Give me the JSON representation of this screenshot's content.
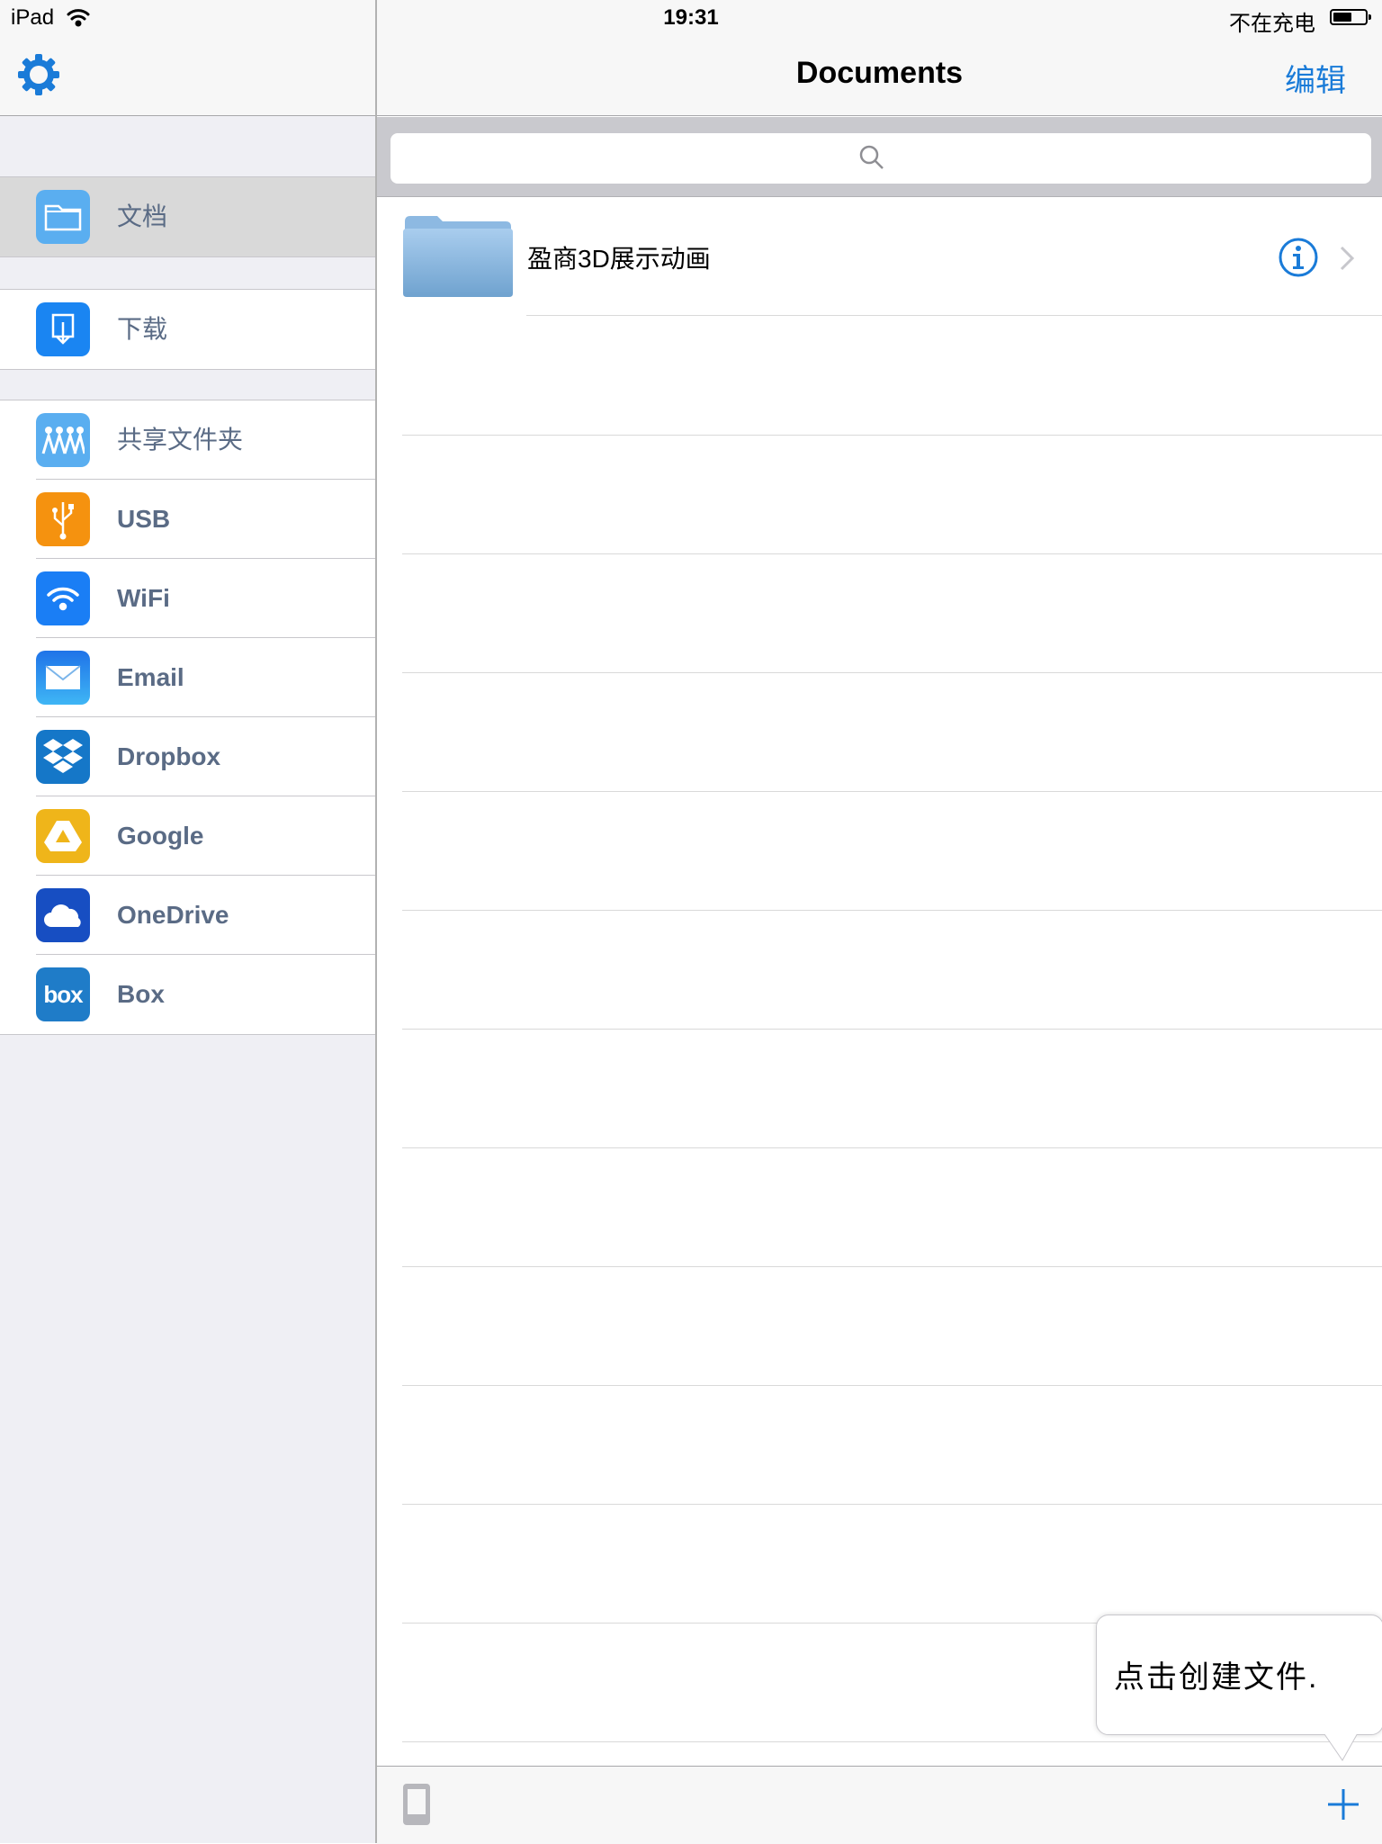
{
  "status_bar": {
    "device": "iPad",
    "time": "19:31",
    "charging": "不在充电",
    "battery_level": 0.6
  },
  "sidebar": {
    "groups": [
      [
        {
          "label": "文档",
          "icon": "folder-icon",
          "active": true
        }
      ],
      [
        {
          "label": "下载",
          "icon": "download-icon"
        }
      ],
      [
        {
          "label": "共享文件夹",
          "icon": "shared-people-icon"
        },
        {
          "label": "USB",
          "icon": "usb-icon"
        },
        {
          "label": "WiFi",
          "icon": "wifi-icon"
        },
        {
          "label": "Email",
          "icon": "envelope-icon"
        },
        {
          "label": "Dropbox",
          "icon": "dropbox-icon"
        },
        {
          "label": "Google",
          "icon": "google-drive-icon"
        },
        {
          "label": "OneDrive",
          "icon": "cloud-icon"
        },
        {
          "label": "Box",
          "icon": "box-logo-icon",
          "logo_text": "box"
        }
      ]
    ]
  },
  "main": {
    "title": "Documents",
    "edit_label": "编辑",
    "search": {
      "placeholder": ""
    },
    "items": [
      {
        "name": "盈商3D展示动画",
        "type": "folder"
      }
    ]
  },
  "tooltip": {
    "text": "点击创建文件."
  },
  "colors": {
    "accent": "#1a7bd8",
    "sidebar_bg": "#efeff4",
    "sidebar_label": "#5a6b85"
  }
}
